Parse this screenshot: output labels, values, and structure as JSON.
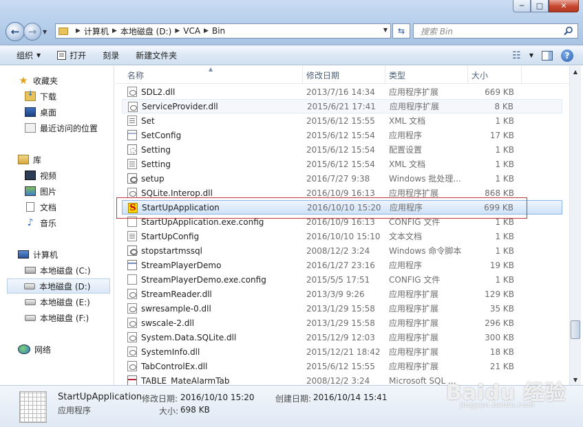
{
  "window": {
    "min_label": "─",
    "max_label": "□",
    "close_label": "✕"
  },
  "address": {
    "crumbs": [
      "计算机",
      "本地磁盘 (D:)",
      "VCA",
      "Bin"
    ]
  },
  "search": {
    "placeholder": "搜索 Bin"
  },
  "toolbar": {
    "organize": "组织",
    "open": "打开",
    "burn": "刻录",
    "new_folder": "新建文件夹"
  },
  "sidebar": {
    "favorites": "收藏夹",
    "downloads": "下载",
    "desktop": "桌面",
    "recent": "最近访问的位置",
    "libraries": "库",
    "videos": "视频",
    "pictures": "图片",
    "documents": "文档",
    "music": "音乐",
    "computer": "计算机",
    "drive_c": "本地磁盘 (C:)",
    "drive_d": "本地磁盘 (D:)",
    "drive_e": "本地磁盘 (E:)",
    "drive_f": "本地磁盘 (F:)",
    "network": "网络"
  },
  "columns": {
    "name": "名称",
    "modified": "修改日期",
    "type": "类型",
    "size": "大小"
  },
  "files": [
    {
      "name": "SDL2.dll",
      "date": "2013/7/16 14:34",
      "type": "应用程序扩展",
      "size": "669 KB",
      "icon": "dll"
    },
    {
      "name": "ServiceProvider.dll",
      "date": "2015/6/21 17:41",
      "type": "应用程序扩展",
      "size": "8 KB",
      "icon": "dll"
    },
    {
      "name": "Set",
      "date": "2015/6/12 15:55",
      "type": "XML 文档",
      "size": "1 KB",
      "icon": "xml"
    },
    {
      "name": "SetConfig",
      "date": "2015/6/12 15:54",
      "type": "应用程序",
      "size": "17 KB",
      "icon": "exe"
    },
    {
      "name": "Setting",
      "date": "2015/6/12 15:54",
      "type": "配置设置",
      "size": "1 KB",
      "icon": "cfg"
    },
    {
      "name": "Setting",
      "date": "2015/6/12 15:54",
      "type": "XML 文档",
      "size": "1 KB",
      "icon": "xml"
    },
    {
      "name": "setup",
      "date": "2016/7/27 9:38",
      "type": "Windows 批处理...",
      "size": "1 KB",
      "icon": "cmd"
    },
    {
      "name": "SQLite.Interop.dll",
      "date": "2016/10/9 16:13",
      "type": "应用程序扩展",
      "size": "868 KB",
      "icon": "dll"
    },
    {
      "name": "StartUpApplication",
      "date": "2016/10/10 15:20",
      "type": "应用程序",
      "size": "699 KB",
      "icon": "s"
    },
    {
      "name": "StartUpApplication.exe.config",
      "date": "2016/10/9 16:13",
      "type": "CONFIG 文件",
      "size": "1 KB",
      "icon": "blank"
    },
    {
      "name": "StartUpConfig",
      "date": "2016/10/10 15:10",
      "type": "文本文档",
      "size": "1 KB",
      "icon": "txt"
    },
    {
      "name": "stopstartmssql",
      "date": "2008/12/2 3:24",
      "type": "Windows 命令脚本",
      "size": "1 KB",
      "icon": "cmd"
    },
    {
      "name": "StreamPlayerDemo",
      "date": "2016/1/27 23:16",
      "type": "应用程序",
      "size": "19 KB",
      "icon": "exe"
    },
    {
      "name": "StreamPlayerDemo.exe.config",
      "date": "2015/5/5 17:51",
      "type": "CONFIG 文件",
      "size": "1 KB",
      "icon": "blank"
    },
    {
      "name": "StreamReader.dll",
      "date": "2013/3/9 9:26",
      "type": "应用程序扩展",
      "size": "129 KB",
      "icon": "dll"
    },
    {
      "name": "swresample-0.dll",
      "date": "2013/1/29 15:58",
      "type": "应用程序扩展",
      "size": "35 KB",
      "icon": "dll"
    },
    {
      "name": "swscale-2.dll",
      "date": "2013/1/29 15:58",
      "type": "应用程序扩展",
      "size": "296 KB",
      "icon": "dll"
    },
    {
      "name": "System.Data.SQLite.dll",
      "date": "2015/12/9 12:03",
      "type": "应用程序扩展",
      "size": "300 KB",
      "icon": "dll"
    },
    {
      "name": "SystemInfo.dll",
      "date": "2015/12/21 18:42",
      "type": "应用程序扩展",
      "size": "18 KB",
      "icon": "dll"
    },
    {
      "name": "TabControlEx.dll",
      "date": "2015/6/12 15:55",
      "type": "应用程序扩展",
      "size": "21 KB",
      "icon": "dll"
    },
    {
      "name": "TABLE_MateAlarmTab",
      "date": "2008/12/2 3:24",
      "type": "Microsoft SQL ...",
      "size": "",
      "icon": "sql"
    }
  ],
  "details": {
    "name": "StartUpApplication",
    "type": "应用程序",
    "modified_label": "修改日期:",
    "modified_value": "2016/10/10 15:20",
    "created_label": "创建日期:",
    "created_value": "2016/10/14 15:41",
    "size_label": "大小:",
    "size_value": "698 KB"
  },
  "watermark": {
    "main": "Baidu 经验",
    "sub": "jingyan.baidu.com"
  }
}
